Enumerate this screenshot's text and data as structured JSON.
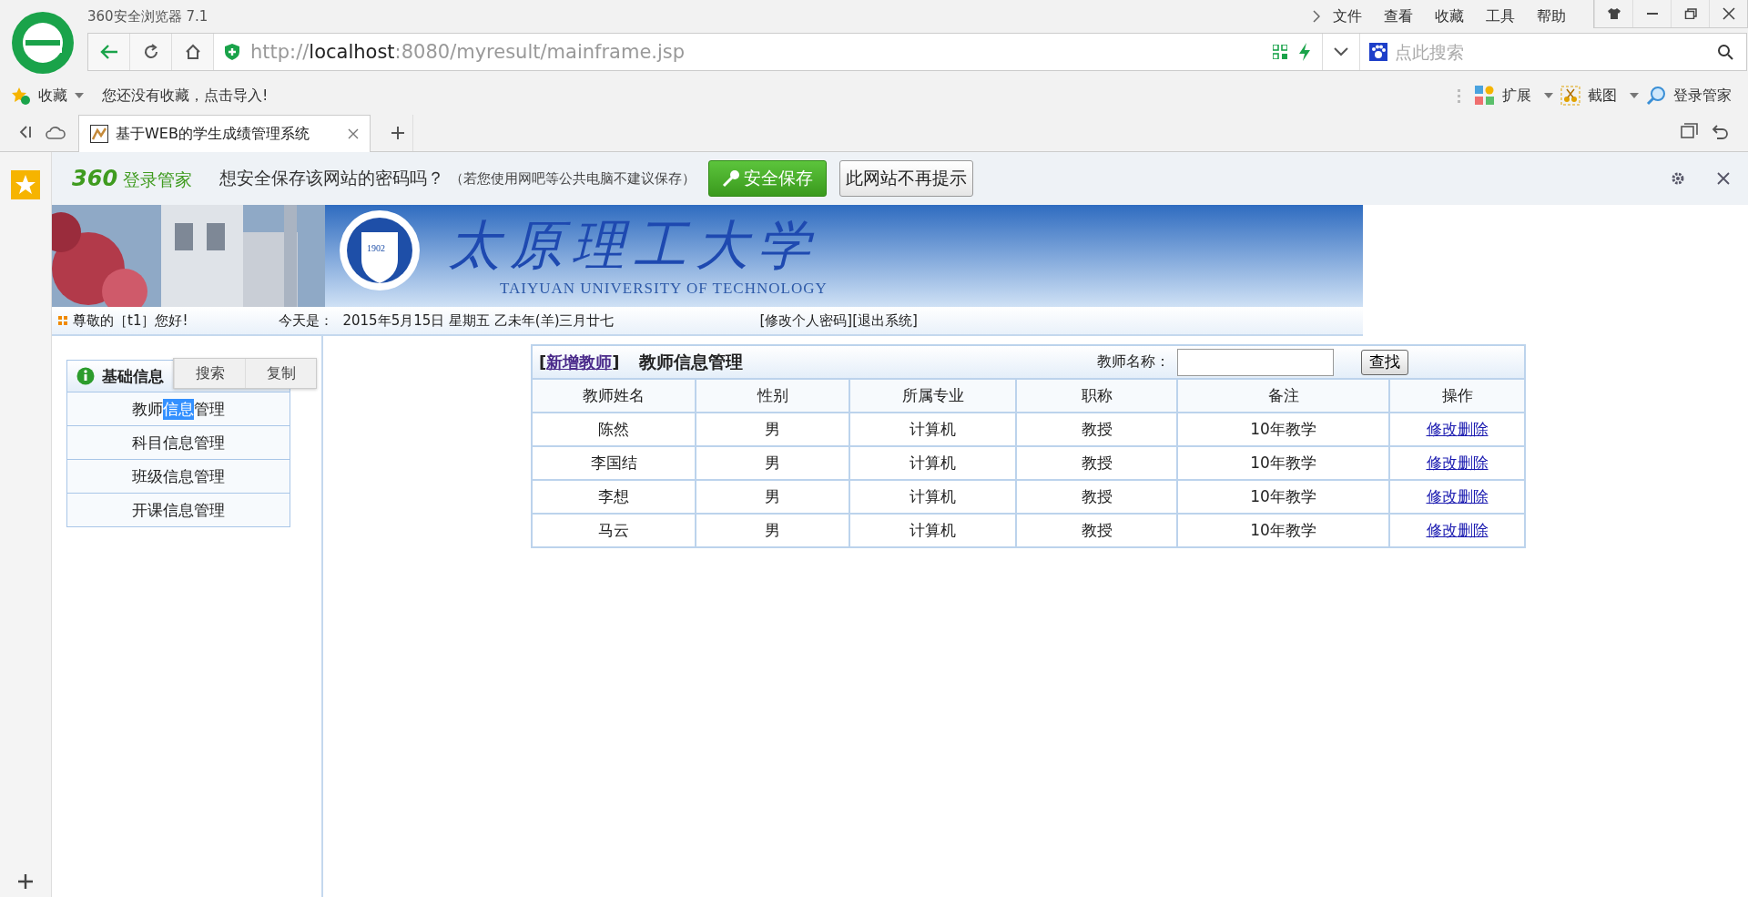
{
  "browser": {
    "title": "360安全浏览器 7.1",
    "menu": [
      "文件",
      "查看",
      "收藏",
      "工具",
      "帮助"
    ],
    "url_scheme": "http://",
    "url_host": "localhost",
    "url_rest": ":8080/myresult/mainframe.jsp",
    "search_placeholder": "点此搜索"
  },
  "bookmarks_bar": {
    "label": "收藏",
    "hint": "您还没有收藏，点击导入!",
    "tools": [
      "扩展",
      "截图",
      "登录管家"
    ]
  },
  "tabs": [
    {
      "label": "基于WEB的学生成绩管理系统",
      "selected": true
    }
  ],
  "password_bar": {
    "brand_number": "360",
    "brand_text": "登录管家",
    "question": "想安全保存该网站的密码吗？",
    "note": "（若您使用网吧等公共电脑不建议保存）",
    "save_button": "安全保存",
    "dismiss_button": "此网站不再提示"
  },
  "banner": {
    "name_cn": "太原理工大学",
    "name_en": "TAIYUAN UNIVERSITY OF TECHNOLOGY",
    "seal_year": "1902"
  },
  "greeting": {
    "welcome": "尊敬的［t1］您好!",
    "date_label": "今天是：",
    "date": "2015年5月15日 星期五 乙未年(羊)三月廿七",
    "links": [
      "[修改个人密码]",
      "[退出系统]"
    ]
  },
  "sidebar": {
    "title": "基础信息",
    "items": [
      {
        "parts": [
          {
            "text": "教师",
            "highlighted": false
          },
          {
            "text": "信息",
            "highlighted": true
          },
          {
            "text": "管理",
            "highlighted": false
          }
        ]
      },
      {
        "parts": [
          {
            "text": "科目信息管理",
            "highlighted": false
          }
        ]
      },
      {
        "parts": [
          {
            "text": "班级信息管理",
            "highlighted": false
          }
        ]
      },
      {
        "parts": [
          {
            "text": "开课信息管理",
            "highlighted": false
          }
        ]
      }
    ]
  },
  "context_menu": [
    "搜索",
    "复制"
  ],
  "teacher_panel": {
    "bracket_open": "[",
    "add_link": "新增教师",
    "bracket_close": "]",
    "title": "教师信息管理",
    "search_label": "教师名称：",
    "search_button": "查找",
    "columns": [
      "教师姓名",
      "性别",
      "所属专业",
      "职称",
      "备注",
      "操作"
    ],
    "rows": [
      {
        "name": "陈然",
        "gender": "男",
        "major": "计算机",
        "rank": "教授",
        "note": "10年教学",
        "actions": [
          "修改",
          "删除"
        ]
      },
      {
        "name": "李国结",
        "gender": "男",
        "major": "计算机",
        "rank": "教授",
        "note": "10年教学",
        "actions": [
          "修改",
          "删除"
        ]
      },
      {
        "name": "李想",
        "gender": "男",
        "major": "计算机",
        "rank": "教授",
        "note": "10年教学",
        "actions": [
          "修改",
          "删除"
        ]
      },
      {
        "name": "马云",
        "gender": "男",
        "major": "计算机",
        "rank": "教授",
        "note": "10年教学",
        "actions": [
          "修改",
          "删除"
        ]
      }
    ]
  }
}
